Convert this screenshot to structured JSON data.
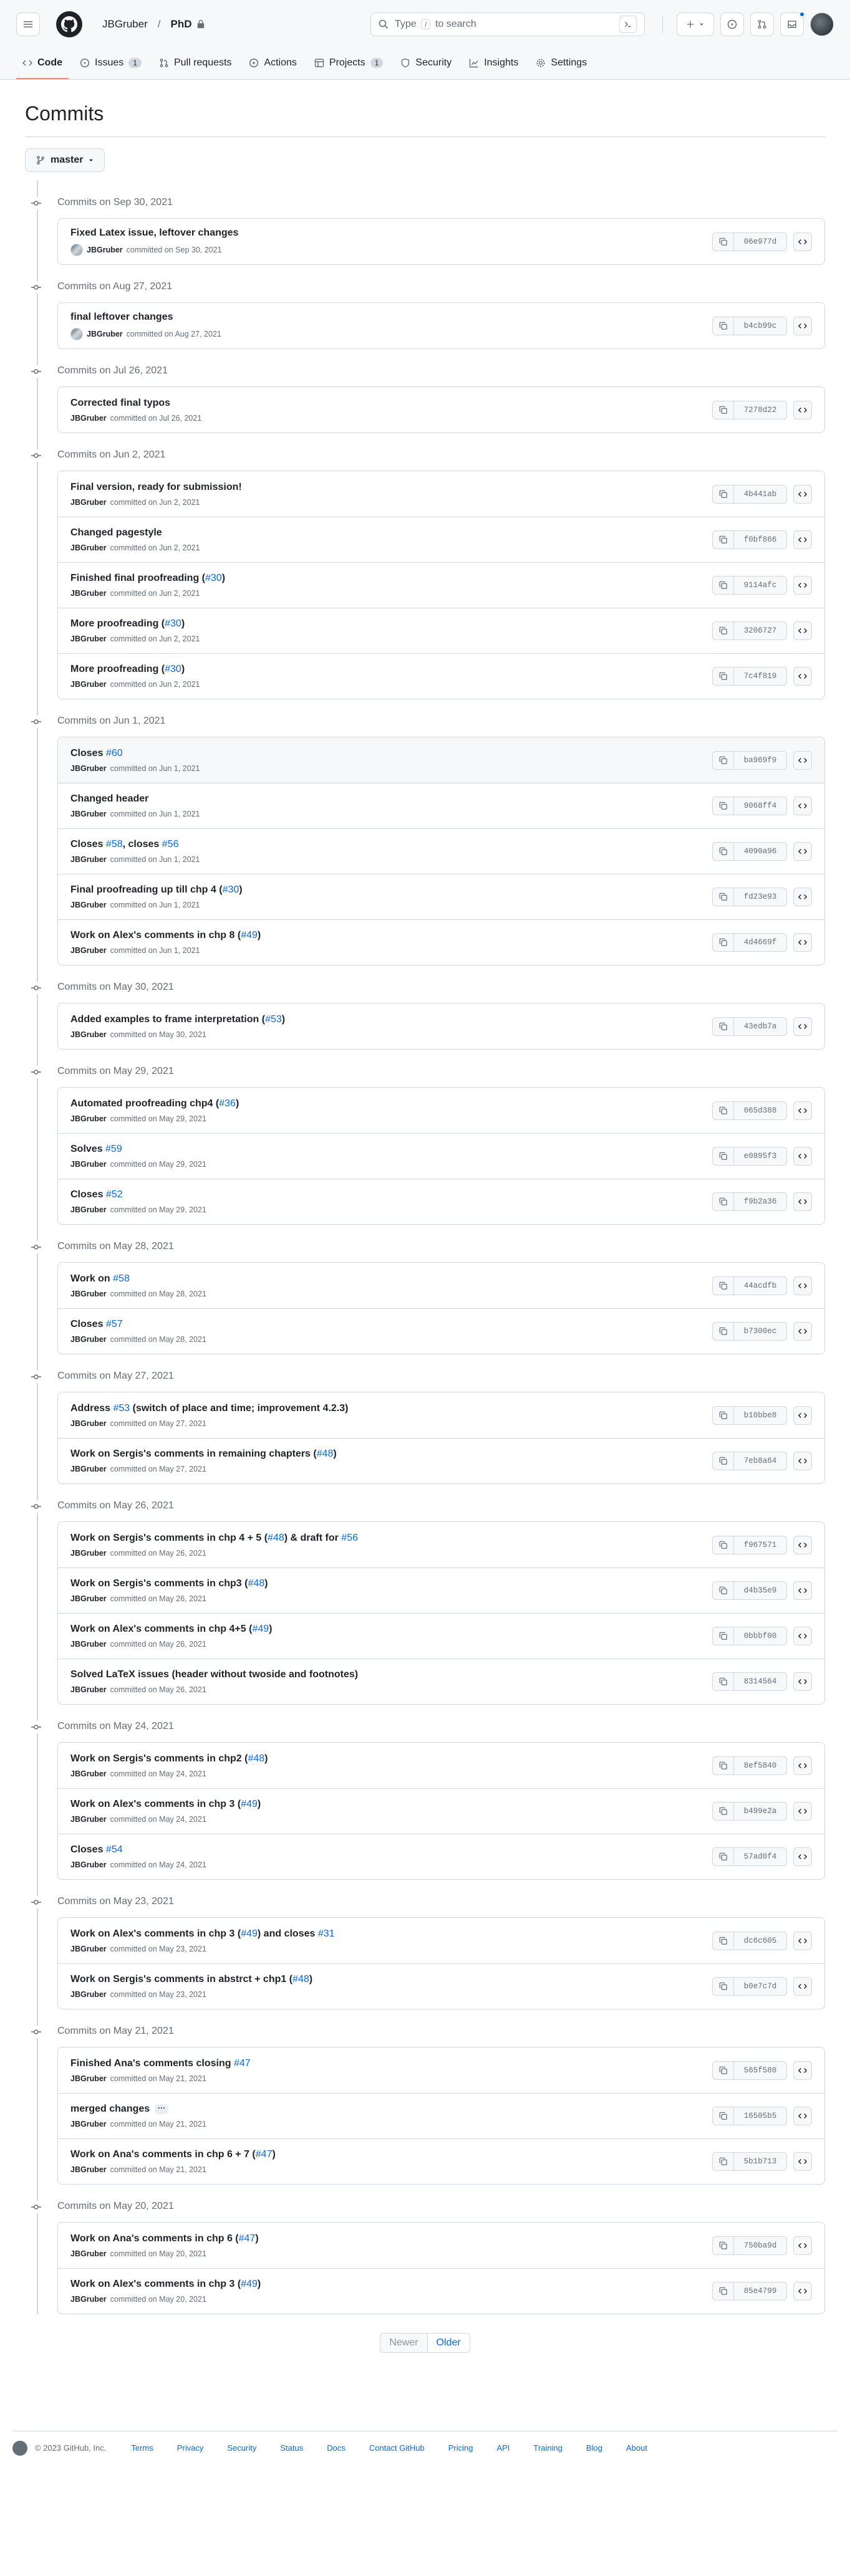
{
  "header": {
    "owner": "JBGruber",
    "repo": "PhD",
    "search_placeholder_before": "Type",
    "search_slash": "/",
    "search_placeholder_after": "to search"
  },
  "tabs": [
    {
      "label": "Code",
      "count": "",
      "icon": "code-icon"
    },
    {
      "label": "Issues",
      "count": "1",
      "icon": "issue-opened-icon"
    },
    {
      "label": "Pull requests",
      "count": "",
      "icon": "git-pull-request-icon"
    },
    {
      "label": "Actions",
      "count": "",
      "icon": "play-icon"
    },
    {
      "label": "Projects",
      "count": "1",
      "icon": "table-icon"
    },
    {
      "label": "Security",
      "count": "",
      "icon": "shield-icon"
    },
    {
      "label": "Insights",
      "count": "",
      "icon": "graph-icon"
    },
    {
      "label": "Settings",
      "count": "",
      "icon": "gear-icon"
    }
  ],
  "page_title": "Commits",
  "branch": "master",
  "groups": [
    {
      "date": "Commits on Sep 30, 2021",
      "commits": [
        {
          "parts": [
            {
              "t": "Fixed Latex issue, leftover changes"
            }
          ],
          "author": "JBGruber",
          "when": "committed on Sep 30, 2021",
          "sha": "06e977d",
          "avatar": true
        }
      ]
    },
    {
      "date": "Commits on Aug 27, 2021",
      "commits": [
        {
          "parts": [
            {
              "t": "final leftover changes"
            }
          ],
          "author": "JBGruber",
          "when": "committed on Aug 27, 2021",
          "sha": "b4cb99c",
          "avatar": true
        }
      ]
    },
    {
      "date": "Commits on Jul 26, 2021",
      "commits": [
        {
          "parts": [
            {
              "t": "Corrected final typos"
            }
          ],
          "author": "JBGruber",
          "when": "committed on Jul 26, 2021",
          "sha": "7278d22"
        }
      ]
    },
    {
      "date": "Commits on Jun 2, 2021",
      "commits": [
        {
          "parts": [
            {
              "t": "Final version, ready for submission!"
            }
          ],
          "author": "JBGruber",
          "when": "committed on Jun 2, 2021",
          "sha": "4b441ab"
        },
        {
          "parts": [
            {
              "t": "Changed pagestyle"
            }
          ],
          "author": "JBGruber",
          "when": "committed on Jun 2, 2021",
          "sha": "f0bf866"
        },
        {
          "parts": [
            {
              "t": "Finished final proofreading ("
            },
            {
              "t": "#30",
              "link": true
            },
            {
              "t": ")"
            }
          ],
          "author": "JBGruber",
          "when": "committed on Jun 2, 2021",
          "sha": "9114afc"
        },
        {
          "parts": [
            {
              "t": "More proofreading ("
            },
            {
              "t": "#30",
              "link": true
            },
            {
              "t": ")"
            }
          ],
          "author": "JBGruber",
          "when": "committed on Jun 2, 2021",
          "sha": "3206727"
        },
        {
          "parts": [
            {
              "t": "More proofreading ("
            },
            {
              "t": "#30",
              "link": true
            },
            {
              "t": ")"
            }
          ],
          "author": "JBGruber",
          "when": "committed on Jun 2, 2021",
          "sha": "7c4f819"
        }
      ]
    },
    {
      "date": "Commits on Jun 1, 2021",
      "commits": [
        {
          "parts": [
            {
              "t": "Closes "
            },
            {
              "t": "#60",
              "link": true
            }
          ],
          "author": "JBGruber",
          "when": "committed on Jun 1, 2021",
          "sha": "ba969f9",
          "highlight": true
        },
        {
          "parts": [
            {
              "t": "Changed header"
            }
          ],
          "author": "JBGruber",
          "when": "committed on Jun 1, 2021",
          "sha": "9068ff4"
        },
        {
          "parts": [
            {
              "t": "Closes "
            },
            {
              "t": "#58",
              "link": true
            },
            {
              "t": ", closes "
            },
            {
              "t": "#56",
              "link": true
            }
          ],
          "author": "JBGruber",
          "when": "committed on Jun 1, 2021",
          "sha": "4090a96"
        },
        {
          "parts": [
            {
              "t": "Final proofreading up till chp 4 ("
            },
            {
              "t": "#30",
              "link": true
            },
            {
              "t": ")"
            }
          ],
          "author": "JBGruber",
          "when": "committed on Jun 1, 2021",
          "sha": "fd23e93"
        },
        {
          "parts": [
            {
              "t": "Work on Alex's comments in chp 8 ("
            },
            {
              "t": "#49",
              "link": true
            },
            {
              "t": ")"
            }
          ],
          "author": "JBGruber",
          "when": "committed on Jun 1, 2021",
          "sha": "4d4669f"
        }
      ]
    },
    {
      "date": "Commits on May 30, 2021",
      "commits": [
        {
          "parts": [
            {
              "t": "Added examples to frame interpretation ("
            },
            {
              "t": "#53",
              "link": true
            },
            {
              "t": ")"
            }
          ],
          "author": "JBGruber",
          "when": "committed on May 30, 2021",
          "sha": "43edb7a"
        }
      ]
    },
    {
      "date": "Commits on May 29, 2021",
      "commits": [
        {
          "parts": [
            {
              "t": "Automated proofreading chp4 ("
            },
            {
              "t": "#36",
              "link": true
            },
            {
              "t": ")"
            }
          ],
          "author": "JBGruber",
          "when": "committed on May 29, 2021",
          "sha": "065d388"
        },
        {
          "parts": [
            {
              "t": "Solves "
            },
            {
              "t": "#59",
              "link": true
            }
          ],
          "author": "JBGruber",
          "when": "committed on May 29, 2021",
          "sha": "e0895f3"
        },
        {
          "parts": [
            {
              "t": "Closes "
            },
            {
              "t": "#52",
              "link": true
            }
          ],
          "author": "JBGruber",
          "when": "committed on May 29, 2021",
          "sha": "f9b2a36"
        }
      ]
    },
    {
      "date": "Commits on May 28, 2021",
      "commits": [
        {
          "parts": [
            {
              "t": "Work on "
            },
            {
              "t": "#58",
              "link": true
            }
          ],
          "author": "JBGruber",
          "when": "committed on May 28, 2021",
          "sha": "44acdfb"
        },
        {
          "parts": [
            {
              "t": "Closes "
            },
            {
              "t": "#57",
              "link": true
            }
          ],
          "author": "JBGruber",
          "when": "committed on May 28, 2021",
          "sha": "b7300ec"
        }
      ]
    },
    {
      "date": "Commits on May 27, 2021",
      "commits": [
        {
          "parts": [
            {
              "t": "Address "
            },
            {
              "t": "#53",
              "link": true
            },
            {
              "t": " (switch of place and time; improvement 4.2.3)"
            }
          ],
          "author": "JBGruber",
          "when": "committed on May 27, 2021",
          "sha": "b10bbe8"
        },
        {
          "parts": [
            {
              "t": "Work on Sergis's comments in remaining chapters ("
            },
            {
              "t": "#48",
              "link": true
            },
            {
              "t": ")"
            }
          ],
          "author": "JBGruber",
          "when": "committed on May 27, 2021",
          "sha": "7eb8a64"
        }
      ]
    },
    {
      "date": "Commits on May 26, 2021",
      "commits": [
        {
          "parts": [
            {
              "t": "Work on Sergis's comments in chp 4 + 5 ("
            },
            {
              "t": "#48",
              "link": true
            },
            {
              "t": ") & draft for "
            },
            {
              "t": "#56",
              "link": true
            }
          ],
          "author": "JBGruber",
          "when": "committed on May 26, 2021",
          "sha": "f967571"
        },
        {
          "parts": [
            {
              "t": "Work on Sergis's comments in chp3 ("
            },
            {
              "t": "#48",
              "link": true
            },
            {
              "t": ")"
            }
          ],
          "author": "JBGruber",
          "when": "committed on May 26, 2021",
          "sha": "d4b35e9"
        },
        {
          "parts": [
            {
              "t": "Work on Alex's comments in chp 4+5 ("
            },
            {
              "t": "#49",
              "link": true
            },
            {
              "t": ")"
            }
          ],
          "author": "JBGruber",
          "when": "committed on May 26, 2021",
          "sha": "0bbbf00"
        },
        {
          "parts": [
            {
              "t": "Solved LaTeX issues (header without twoside and footnotes)"
            }
          ],
          "author": "JBGruber",
          "when": "committed on May 26, 2021",
          "sha": "8314564"
        }
      ]
    },
    {
      "date": "Commits on May 24, 2021",
      "commits": [
        {
          "parts": [
            {
              "t": "Work on Sergis's comments in chp2 ("
            },
            {
              "t": "#48",
              "link": true
            },
            {
              "t": ")"
            }
          ],
          "author": "JBGruber",
          "when": "committed on May 24, 2021",
          "sha": "8ef5840"
        },
        {
          "parts": [
            {
              "t": "Work on Alex's comments in chp 3 ("
            },
            {
              "t": "#49",
              "link": true
            },
            {
              "t": ")"
            }
          ],
          "author": "JBGruber",
          "when": "committed on May 24, 2021",
          "sha": "b499e2a"
        },
        {
          "parts": [
            {
              "t": "Closes "
            },
            {
              "t": "#54",
              "link": true
            }
          ],
          "author": "JBGruber",
          "when": "committed on May 24, 2021",
          "sha": "57ad0f4"
        }
      ]
    },
    {
      "date": "Commits on May 23, 2021",
      "commits": [
        {
          "parts": [
            {
              "t": "Work on Alex's comments in chp 3 ("
            },
            {
              "t": "#49",
              "link": true
            },
            {
              "t": ") and closes "
            },
            {
              "t": "#31",
              "link": true
            }
          ],
          "author": "JBGruber",
          "when": "committed on May 23, 2021",
          "sha": "dc6c605"
        },
        {
          "parts": [
            {
              "t": "Work on Sergis's comments in abstrct + chp1 ("
            },
            {
              "t": "#48",
              "link": true
            },
            {
              "t": ")"
            }
          ],
          "author": "JBGruber",
          "when": "committed on May 23, 2021",
          "sha": "b0e7c7d"
        }
      ]
    },
    {
      "date": "Commits on May 21, 2021",
      "commits": [
        {
          "parts": [
            {
              "t": "Finished Ana's comments closing "
            },
            {
              "t": "#47",
              "link": true
            }
          ],
          "author": "JBGruber",
          "when": "committed on May 21, 2021",
          "sha": "565f580"
        },
        {
          "parts": [
            {
              "t": "merged changes"
            }
          ],
          "author": "JBGruber",
          "when": "committed on May 21, 2021",
          "sha": "16505b5",
          "ellipsis": true
        },
        {
          "parts": [
            {
              "t": "Work on Ana's comments in chp 6 + 7 ("
            },
            {
              "t": "#47",
              "link": true
            },
            {
              "t": ")"
            }
          ],
          "author": "JBGruber",
          "when": "committed on May 21, 2021",
          "sha": "5b1b713"
        }
      ]
    },
    {
      "date": "Commits on May 20, 2021",
      "commits": [
        {
          "parts": [
            {
              "t": "Work on Ana's comments in chp 6 ("
            },
            {
              "t": "#47",
              "link": true
            },
            {
              "t": ")"
            }
          ],
          "author": "JBGruber",
          "when": "committed on May 20, 2021",
          "sha": "750ba9d"
        },
        {
          "parts": [
            {
              "t": "Work on Alex's comments in chp 3 ("
            },
            {
              "t": "#49",
              "link": true
            },
            {
              "t": ")"
            }
          ],
          "author": "JBGruber",
          "when": "committed on May 20, 2021",
          "sha": "85e4799"
        }
      ]
    }
  ],
  "pagination": {
    "newer": "Newer",
    "older": "Older"
  },
  "footer": {
    "copyright": "© 2023 GitHub, Inc.",
    "links": [
      "Terms",
      "Privacy",
      "Security",
      "Status",
      "Docs",
      "Contact GitHub",
      "Pricing",
      "API",
      "Training",
      "Blog",
      "About"
    ]
  },
  "colors": {
    "accent": "#0969da",
    "tab_underline": "#fd8c73",
    "border": "#d0d7de",
    "muted": "#656d76"
  }
}
